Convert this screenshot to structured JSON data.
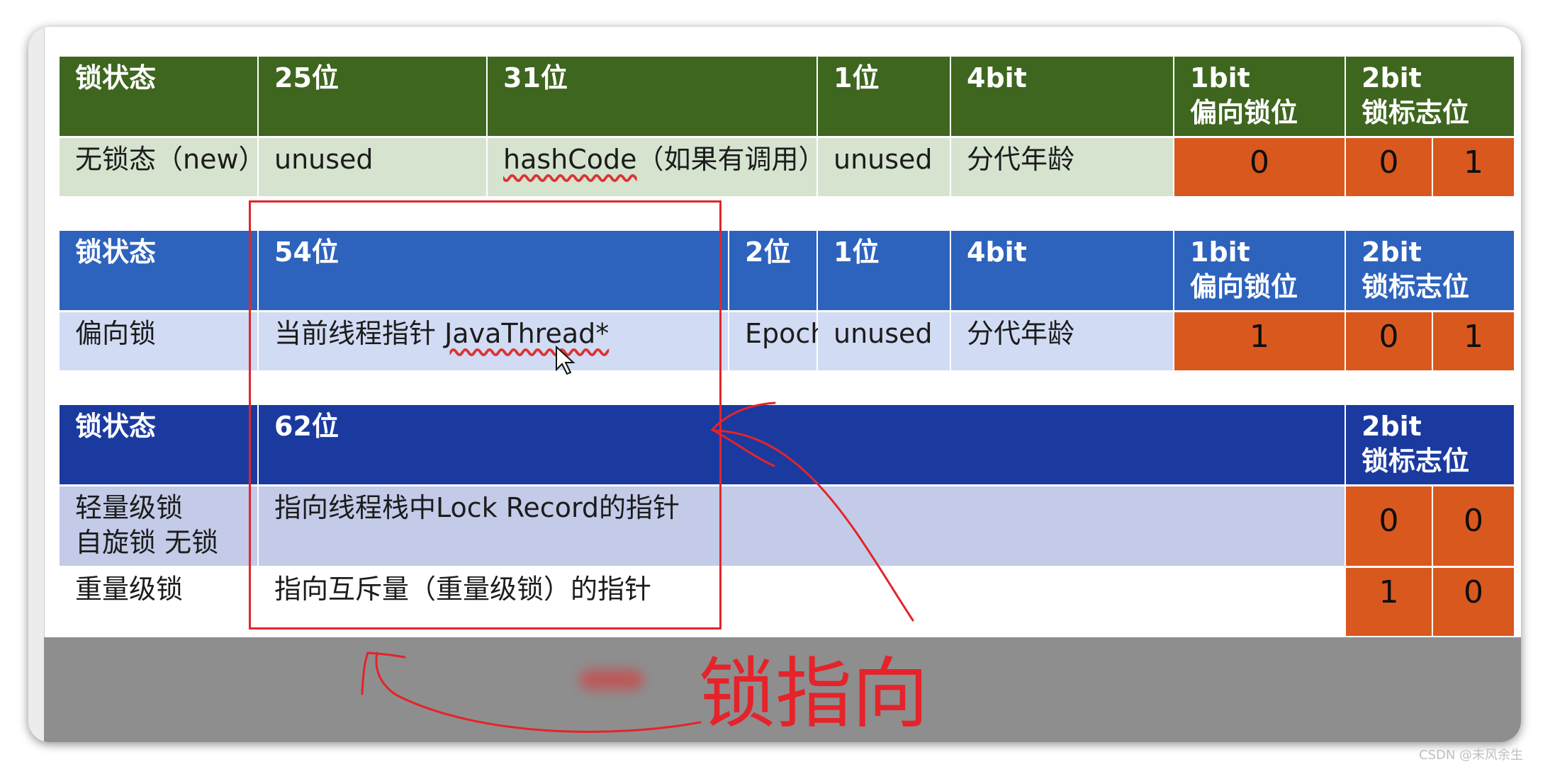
{
  "table1": {
    "header": [
      "锁状态",
      "25位",
      "31位",
      "1位",
      "4bit",
      "1bit",
      "偏向锁位",
      "2bit",
      "锁标志位"
    ],
    "row": {
      "state": "无锁态（new）",
      "c25": "unused",
      "c31": "hashCode",
      "c31_note": "（如果有调用）",
      "c1": "unused",
      "c4": "分代年龄",
      "biased": "0",
      "flag": [
        "0",
        "1"
      ]
    }
  },
  "table2": {
    "header": [
      "锁状态",
      "54位",
      "2位",
      "1位",
      "4bit",
      "1bit",
      "偏向锁位",
      "2bit",
      "锁标志位"
    ],
    "row": {
      "state": "偏向锁",
      "c54_prefix": "当前线程指针 ",
      "c54_thread": "JavaThread*",
      "c2": "Epoch",
      "c1": "unused",
      "c4": "分代年龄",
      "biased": "1",
      "flag": [
        "0",
        "1"
      ]
    }
  },
  "table3": {
    "header": [
      "锁状态",
      "62位",
      "2bit",
      "锁标志位"
    ],
    "rows": [
      {
        "state_line1": "轻量级锁",
        "state_line2": "自旋锁 无锁",
        "pointer": "指向线程栈中Lock Record的指针",
        "flag": [
          "0",
          "0"
        ]
      },
      {
        "state_line1": "重量级锁",
        "pointer": "指向互斥量（重量级锁）的指针",
        "flag": [
          "1",
          "0"
        ]
      }
    ]
  },
  "annotation": {
    "text": "锁指向",
    "color": "#e5232a"
  },
  "watermark": "CSDN @未风余生",
  "colors": {
    "green_dark": "#3e661e",
    "green_light": "#d6e3cf",
    "blue": "#2d63bd",
    "blue_light": "#d1dbf3",
    "navy": "#1b3aa0",
    "navy_light": "#c3cbe8",
    "orange": "#d9581e"
  }
}
